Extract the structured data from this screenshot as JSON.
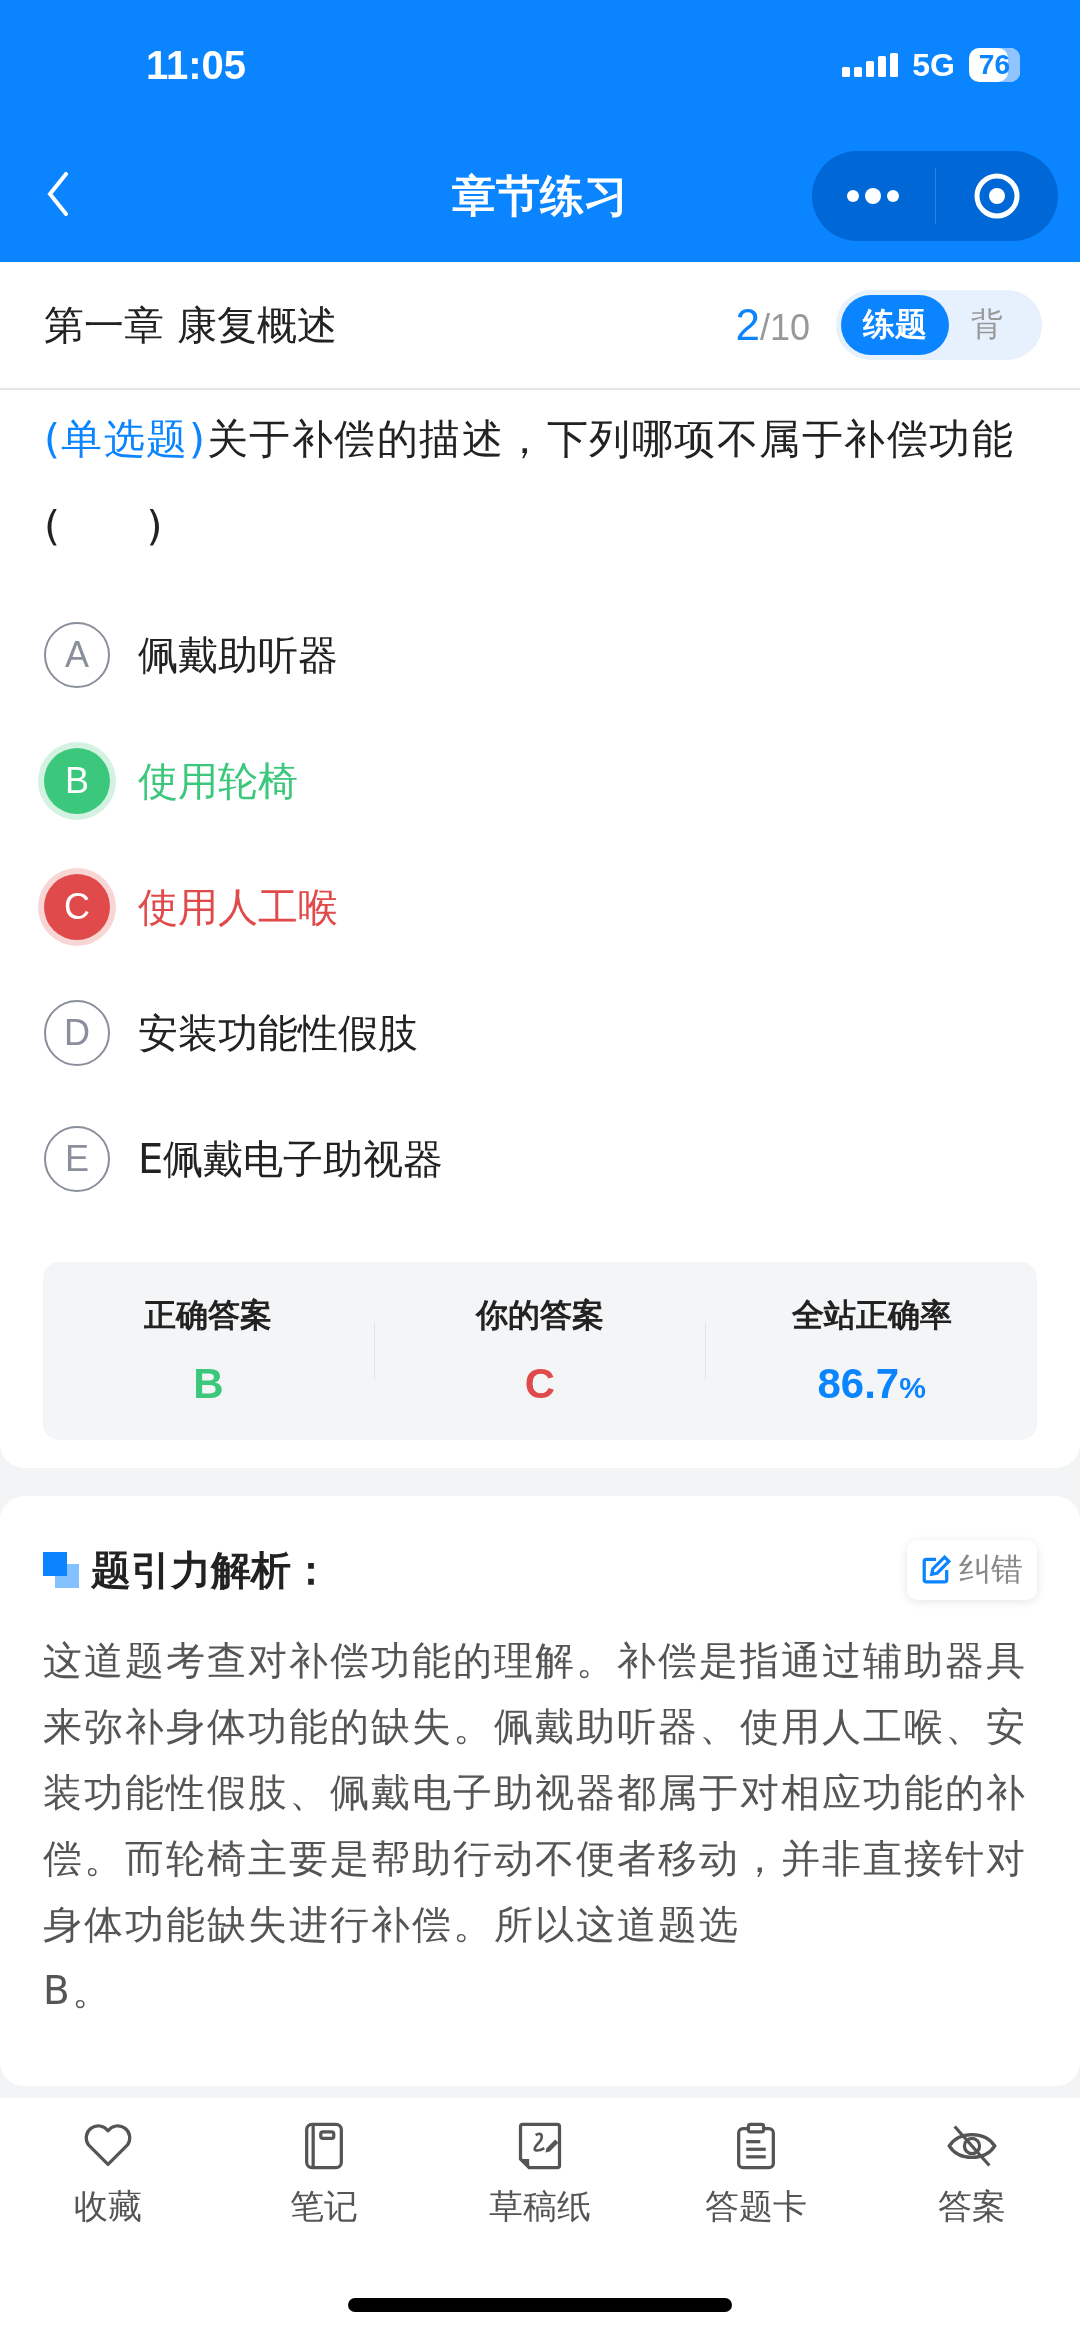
{
  "status_bar": {
    "time": "11:05",
    "network": "5G",
    "battery": "76"
  },
  "nav": {
    "title": "章节练习"
  },
  "header": {
    "chapter": "第一章 康复概述",
    "current": "2",
    "total": "/10",
    "modes": [
      {
        "label": "练题",
        "selected": true
      },
      {
        "label": "背",
        "selected": false
      }
    ]
  },
  "question": {
    "type": "(单选题)",
    "text": "关于补偿的描述，下列哪项不属于补偿功能(　　)",
    "options": [
      {
        "letter": "A",
        "text": "佩戴助听器",
        "kind": "plain"
      },
      {
        "letter": "B",
        "text": "使用轮椅",
        "kind": "correct"
      },
      {
        "letter": "C",
        "text": "使用人工喉",
        "kind": "wrong"
      },
      {
        "letter": "D",
        "text": "安装功能性假肢",
        "kind": "plain"
      },
      {
        "letter": "E",
        "text": "E佩戴电子助视器",
        "kind": "plain"
      }
    ]
  },
  "stats": [
    {
      "label": "正确答案",
      "value": "B",
      "kind": "correct"
    },
    {
      "label": "你的答案",
      "value": "C",
      "kind": "wrong"
    },
    {
      "label": "全站正确率",
      "value": "86.7",
      "unit": "%",
      "kind": "rate"
    }
  ],
  "analysis": {
    "title": "题引力解析：",
    "report_button": "纠错",
    "text": "这道题考查对补偿功能的理解。补偿是指通过辅助器具来弥补身体功能的缺失。佩戴助听器、使用人工喉、安装功能性假肢、佩戴电子助视器都属于对相应功能的补偿。而轮椅主要是帮助行动不便者移动，并非直接针对身体功能缺失进行补偿。所以这道题选\nB。"
  },
  "toolbar": [
    {
      "label": "收藏",
      "kind": "favorite"
    },
    {
      "label": "笔记",
      "kind": "notes"
    },
    {
      "label": "草稿纸",
      "kind": "draft"
    },
    {
      "label": "答题卡",
      "kind": "card"
    },
    {
      "label": "答案",
      "kind": "answer"
    }
  ]
}
